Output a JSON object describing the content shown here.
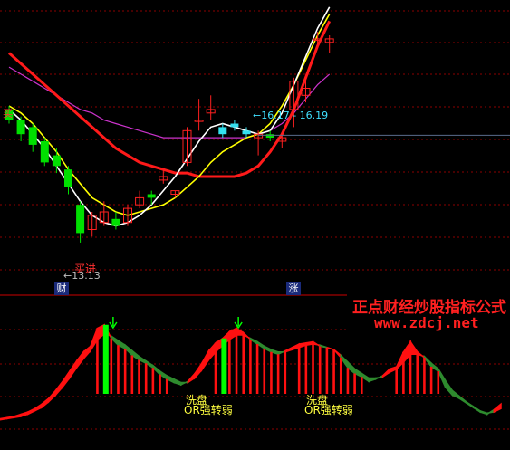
{
  "colors": {
    "background": "#000000",
    "up_candle": "#ff2020",
    "down_candle": "#00e000",
    "cyan_candle": "#33e0ee",
    "ma_white": "#ffffff",
    "ma_yellow": "#ffff00",
    "ma_red": "#ff1a1a",
    "ma_magenta": "#cc33cc",
    "grid": "#8b0000",
    "price_line": "#5a6c8c",
    "text_red": "#ff3030",
    "text_yellow": "#ffff40",
    "text_cyan": "#40e0ff",
    "text_gray": "#c0c0c0",
    "arrow": "#00ff00"
  },
  "badges": {
    "left": "财",
    "mid": "涨"
  },
  "watermark": {
    "line1": "正点财经炒股指标公式",
    "line2": "www.zdcj.net"
  },
  "annotations": {
    "buy_signal": "买进",
    "low_price_marker": "←13.13",
    "range_marker": "←16.17 - 16.19",
    "top_left_label": "买",
    "indicator_label_top_1": "洗盘",
    "indicator_label_bottom_1": "OR强转弱",
    "indicator_label_top_2": "洗盘",
    "indicator_label_bottom_2": "OR强转弱"
  },
  "chart_data": [
    {
      "type": "candlestick",
      "title": "",
      "candles": [
        {
          "i": 0,
          "o": 16.9,
          "c": 16.6,
          "h": 17.0,
          "l": 16.5
        },
        {
          "i": 1,
          "o": 16.6,
          "c": 16.2,
          "h": 16.7,
          "l": 16.0
        },
        {
          "i": 2,
          "o": 16.4,
          "c": 15.9,
          "h": 16.5,
          "l": 15.7
        },
        {
          "i": 3,
          "o": 16.0,
          "c": 15.4,
          "h": 16.1,
          "l": 15.3
        },
        {
          "i": 4,
          "o": 15.6,
          "c": 15.3,
          "h": 15.8,
          "l": 15.1
        },
        {
          "i": 5,
          "o": 15.2,
          "c": 14.7,
          "h": 15.3,
          "l": 14.5
        },
        {
          "i": 6,
          "o": 14.2,
          "c": 13.4,
          "h": 14.3,
          "l": 13.13
        },
        {
          "i": 7,
          "o": 13.5,
          "c": 13.9,
          "h": 14.0,
          "l": 13.3
        },
        {
          "i": 8,
          "o": 13.7,
          "c": 14.0,
          "h": 14.3,
          "l": 13.6
        },
        {
          "i": 9,
          "o": 13.8,
          "c": 13.6,
          "h": 14.0,
          "l": 13.5
        },
        {
          "i": 10,
          "o": 13.7,
          "c": 14.1,
          "h": 14.2,
          "l": 13.6
        },
        {
          "i": 11,
          "o": 14.2,
          "c": 14.4,
          "h": 14.6,
          "l": 14.1
        },
        {
          "i": 12,
          "o": 14.5,
          "c": 14.4,
          "h": 14.6,
          "l": 14.2
        },
        {
          "i": 13,
          "o": 14.9,
          "c": 15.0,
          "h": 15.2,
          "l": 14.8
        },
        {
          "i": 14,
          "o": 14.5,
          "c": 14.6,
          "h": 14.6,
          "l": 14.4
        },
        {
          "i": 15,
          "o": 15.4,
          "c": 16.3,
          "h": 16.4,
          "l": 15.3
        },
        {
          "i": 16,
          "o": 16.6,
          "c": 16.6,
          "h": 17.2,
          "l": 16.3
        },
        {
          "i": 17,
          "o": 16.8,
          "c": 16.9,
          "h": 17.3,
          "l": 16.6
        },
        {
          "i": 18,
          "o": 16.4,
          "c": 16.2,
          "h": 16.5,
          "l": 16.1
        },
        {
          "i": 19,
          "o": 16.5,
          "c": 16.4,
          "h": 16.6,
          "l": 16.3
        },
        {
          "i": 20,
          "o": 16.3,
          "c": 16.2,
          "h": 16.4,
          "l": 16.1
        },
        {
          "i": 21,
          "o": 16.1,
          "c": 16.2,
          "h": 16.3,
          "l": 15.6
        },
        {
          "i": 22,
          "o": 16.2,
          "c": 16.1,
          "h": 16.3,
          "l": 16.0
        },
        {
          "i": 23,
          "o": 16.0,
          "c": 16.1,
          "h": 16.2,
          "l": 15.8
        },
        {
          "i": 24,
          "o": 16.9,
          "c": 17.7,
          "h": 17.8,
          "l": 16.4
        },
        {
          "i": 25,
          "o": 17.3,
          "c": 17.5,
          "h": 17.8,
          "l": 17.1
        },
        {
          "i": 26,
          "o": 18.9,
          "c": 18.9,
          "h": 19.1,
          "l": 18.7
        },
        {
          "i": 27,
          "o": 18.8,
          "c": 18.9,
          "h": 19.0,
          "l": 18.5
        }
      ],
      "ma_white": [
        16.9,
        16.6,
        16.2,
        15.8,
        15.3,
        14.8,
        14.3,
        13.9,
        13.7,
        13.6,
        13.7,
        13.9,
        14.2,
        14.6,
        15.0,
        15.5,
        16.0,
        16.4,
        16.5,
        16.4,
        16.3,
        16.2,
        16.3,
        16.8,
        17.6,
        18.4,
        19.2,
        19.8
      ],
      "ma_yellow": [
        17.0,
        16.8,
        16.5,
        16.1,
        15.7,
        15.2,
        14.8,
        14.4,
        14.2,
        14.0,
        13.9,
        14.0,
        14.1,
        14.2,
        14.4,
        14.7,
        15.0,
        15.4,
        15.7,
        15.9,
        16.1,
        16.2,
        16.5,
        17.0,
        17.6,
        18.3,
        19.0,
        19.6
      ],
      "ma_red": [
        18.5,
        18.2,
        17.9,
        17.6,
        17.3,
        17.0,
        16.7,
        16.4,
        16.1,
        15.8,
        15.6,
        15.4,
        15.3,
        15.2,
        15.1,
        15.1,
        15.0,
        15.0,
        15.0,
        15.0,
        15.1,
        15.3,
        15.7,
        16.2,
        16.9,
        17.8,
        18.7,
        19.4
      ],
      "ma_magenta": [
        18.1,
        17.9,
        17.7,
        17.5,
        17.3,
        17.1,
        16.9,
        16.8,
        16.6,
        16.5,
        16.4,
        16.3,
        16.2,
        16.1,
        16.1,
        16.1,
        16.1,
        16.1,
        16.1,
        16.1,
        16.1,
        16.2,
        16.3,
        16.5,
        16.8,
        17.2,
        17.6,
        17.9
      ],
      "price_markers": [
        13.13,
        16.17,
        16.19
      ]
    },
    {
      "type": "bar",
      "title": "",
      "indicator_values": [
        0.6,
        0.7,
        0.8,
        1.0,
        1.2,
        1.5,
        1.9,
        2.4,
        3.1,
        3.9,
        4.8,
        5.7,
        6.5,
        7.0,
        8.6,
        8.9,
        7.7,
        7.1,
        6.8,
        6.2,
        5.8,
        5.5,
        5.1,
        4.5,
        4.1,
        3.8,
        3.6,
        3.9,
        4.6,
        5.5,
        6.6,
        7.3,
        7.7,
        8.3,
        8.6,
        8.2,
        7.6,
        7.2,
        6.8,
        6.5,
        6.3,
        6.6,
        6.9,
        7.2,
        7.3,
        7.4,
        7.0,
        6.9,
        6.7,
        6.0,
        5.1,
        4.6,
        4.3,
        3.9,
        4.1,
        4.4,
        5.0,
        5.2,
        6.5,
        7.4,
        6.5,
        6.0,
        5.2,
        4.8,
        3.4,
        2.7,
        2.4,
        2.0,
        1.6,
        1.2,
        1.0,
        1.4,
        1.9
      ],
      "signal_line": [
        0.5,
        0.6,
        0.7,
        0.8,
        1.0,
        1.3,
        1.6,
        2.1,
        2.7,
        3.4,
        4.2,
        5.1,
        5.9,
        6.6,
        7.6,
        8.1,
        7.9,
        7.5,
        7.1,
        6.6,
        6.1,
        5.7,
        5.3,
        4.8,
        4.4,
        4.1,
        3.8,
        3.8,
        4.2,
        4.9,
        5.8,
        6.5,
        7.1,
        7.6,
        8.0,
        8.0,
        7.7,
        7.4,
        7.0,
        6.7,
        6.5,
        6.5,
        6.7,
        6.9,
        7.1,
        7.2,
        7.1,
        6.9,
        6.7,
        6.2,
        5.6,
        5.0,
        4.6,
        4.2,
        4.2,
        4.3,
        4.7,
        5.0,
        5.6,
        6.3,
        6.3,
        6.1,
        5.5,
        5.0,
        4.0,
        3.1,
        2.6,
        2.1,
        1.7,
        1.3,
        1.1,
        1.2,
        1.5
      ],
      "green_bar_index": [
        15,
        32
      ],
      "arrow_index": [
        16,
        34
      ]
    }
  ]
}
